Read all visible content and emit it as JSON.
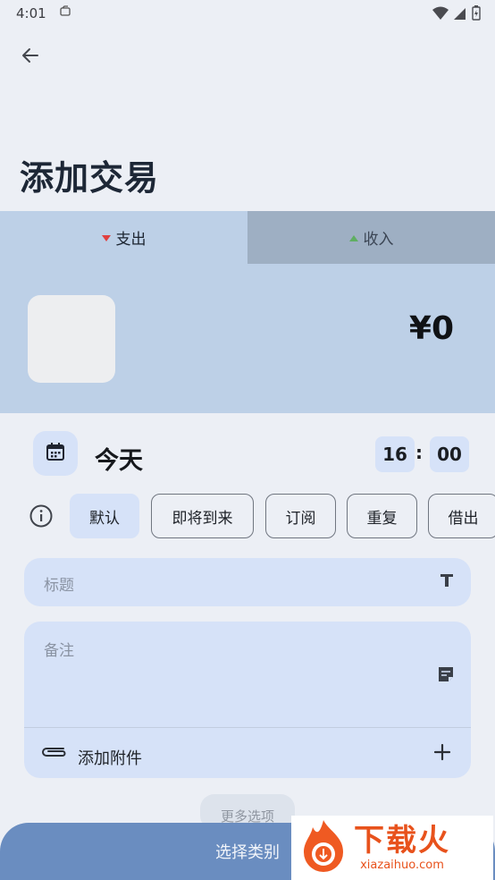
{
  "status_bar": {
    "time": "4:01"
  },
  "page": {
    "title": "添加交易"
  },
  "type_tabs": {
    "expense": "支出",
    "income": "收入"
  },
  "amount": {
    "display": "¥0"
  },
  "date": {
    "label": "今天",
    "hour": "16",
    "colon": ":",
    "minute": "00"
  },
  "chips": [
    {
      "label": "默认",
      "active": true
    },
    {
      "label": "即将到来",
      "active": false
    },
    {
      "label": "订阅",
      "active": false
    },
    {
      "label": "重复",
      "active": false
    },
    {
      "label": "借出",
      "active": false
    }
  ],
  "title_field": {
    "placeholder": "标题"
  },
  "note_field": {
    "placeholder": "备注"
  },
  "attachment": {
    "label": "添加附件"
  },
  "more_options": {
    "label": "更多选项"
  },
  "bottom_button": {
    "label": "选择类别"
  },
  "watermark": {
    "brand": "下载火",
    "url": "xiazaihuo.com"
  },
  "colors": {
    "expense_arrow": "#e04040",
    "income_arrow": "#5fae62",
    "accent": "#6a8dc0"
  }
}
